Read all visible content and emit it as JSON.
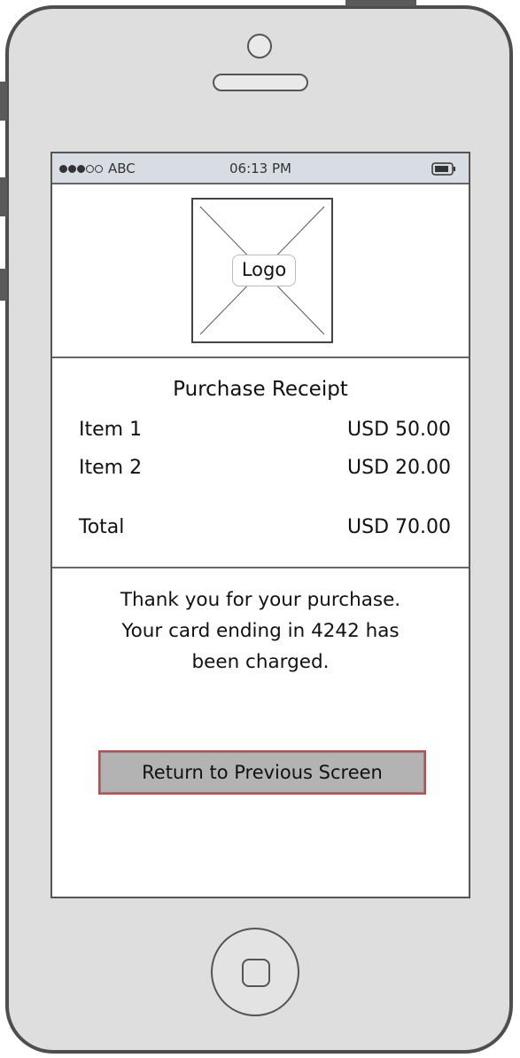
{
  "status_bar": {
    "carrier": "ABC",
    "time": "06:13 PM",
    "signal_bars_filled": 3,
    "signal_bars_total": 5
  },
  "logo": {
    "label": "Logo"
  },
  "receipt": {
    "title": "Purchase Receipt",
    "items": [
      {
        "name": "Item 1",
        "price": "USD 50.00"
      },
      {
        "name": "Item 2",
        "price": "USD 20.00"
      }
    ],
    "total_label": "Total",
    "total_value": "USD 70.00"
  },
  "message": {
    "line1": "Thank you for your purchase.",
    "line2": "Your card ending in 4242 has",
    "line3": "been charged."
  },
  "actions": {
    "return_label": "Return to Previous Screen"
  },
  "colors": {
    "status_bar_bg": "#d8dde3",
    "button_bg": "#b3b3b3",
    "button_border": "#c24a4a"
  }
}
